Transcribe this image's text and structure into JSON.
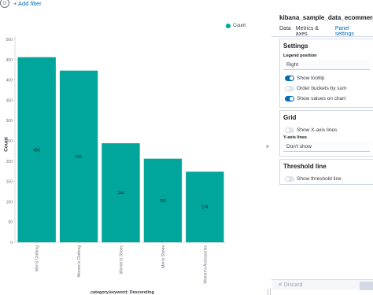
{
  "filter_bar": {
    "add_filter_label": "+ Add filter"
  },
  "chart_data": {
    "type": "bar",
    "categories": [
      "Men's Clothing",
      "Women's Clothing",
      "Women's Shoes",
      "Men's Shoes",
      "Women's Accessories"
    ],
    "values": [
      456,
      423,
      244,
      206,
      174
    ],
    "data_labels": [
      "456",
      "423",
      "244",
      "206",
      "174"
    ],
    "series": [
      {
        "name": "Count",
        "values": [
          456,
          423,
          244,
          206,
          174
        ]
      }
    ],
    "xlabel": "category.keyword: Descending",
    "ylabel": "Count",
    "ylim": [
      0,
      500
    ],
    "yticks": [
      "0",
      "50",
      "100",
      "150",
      "200",
      "250",
      "300",
      "350",
      "400",
      "450",
      "500"
    ],
    "legend": "top-right",
    "grid": false,
    "bar_color": "#00a69b"
  },
  "panel": {
    "index_name": "kibana_sample_data_ecommerce",
    "tabs": [
      {
        "label": "Data"
      },
      {
        "label": "Metrics & axes"
      },
      {
        "label": "Panel settings"
      }
    ],
    "settings": {
      "title": "Settings",
      "legend_position_label": "Legend position",
      "legend_position_value": "Right",
      "show_tooltip": "Show tooltip",
      "order_buckets": "Order buckets by sum",
      "show_values": "Show values on chart"
    },
    "grid": {
      "title": "Grid",
      "show_x_axis_lines": "Show X-axis lines",
      "y_axis_lines_label": "Y-axis lines",
      "y_axis_lines_value": "Don't show"
    },
    "threshold": {
      "title": "Threshold line",
      "show_threshold_line": "Show threshold line"
    },
    "footer": {
      "discard_label": "✕ Discard"
    }
  },
  "colors": {
    "accent": "#006bb4",
    "bar": "#00a69b"
  }
}
